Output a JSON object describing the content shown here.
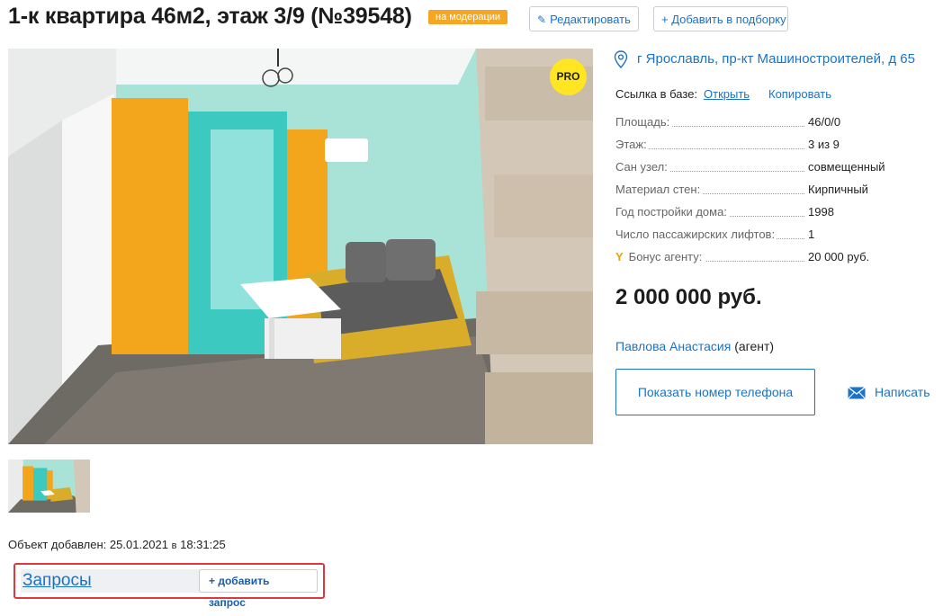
{
  "header": {
    "title": "1-к квартира 46м2, этаж 3/9 (№39548)",
    "status_badge": "на модерации",
    "edit_label": "Редактировать",
    "add_to_selection_label": "+ Добавить в подборку"
  },
  "photo": {
    "pro_badge": "PRO"
  },
  "meta": {
    "added_label": "Объект добавлен:",
    "added_date": "25.01.2021",
    "added_time_prefix": "в",
    "added_time": "18:31:25"
  },
  "requests": {
    "title": "Запросы",
    "add_label": "+ добавить запрос"
  },
  "details": {
    "address": "г Ярославль, пр-кт Машиностроителей, д 65",
    "db_link_label": "Ссылка в базе:",
    "open_label": "Открыть",
    "copy_label": "Копировать",
    "properties": [
      {
        "key": "Площадь:",
        "value": "46/0/0"
      },
      {
        "key": "Этаж:",
        "value": "3 из 9"
      },
      {
        "key": "Сан узел:",
        "value": "совмещенный"
      },
      {
        "key": "Материал стен:",
        "value": "Кирпичный"
      },
      {
        "key": "Год постройки дома:",
        "value": "1998"
      },
      {
        "key": "Число пассажирских лифтов:",
        "value": "1"
      },
      {
        "key": "Бонус агенту:",
        "value": "20 000 руб."
      }
    ],
    "price": "2 000 000 руб.",
    "agent_name": "Павлова Анастасия",
    "agent_role": "(агент)",
    "show_phone_label": "Показать номер телефона",
    "write_label": "Написать"
  },
  "colors": {
    "accent": "#1a73c7",
    "badge": "#f5a623",
    "pro": "#ffe522",
    "highlight_border": "#e0383f"
  }
}
